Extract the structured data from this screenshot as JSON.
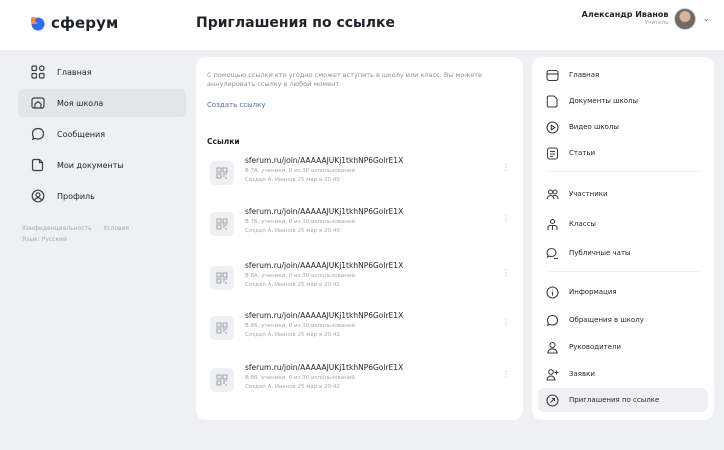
{
  "header": {
    "logo_text": "сферум",
    "page_title": "Приглашения по ссылке",
    "user_name": "Александр Иванов",
    "user_role": "Учитель"
  },
  "left_nav": {
    "items": [
      {
        "label": "Главная",
        "icon": "grid-icon",
        "active": false
      },
      {
        "label": "Моя школа",
        "icon": "school-icon",
        "active": true
      },
      {
        "label": "Сообщения",
        "icon": "chat-icon",
        "active": false
      },
      {
        "label": "Мои документы",
        "icon": "document-icon",
        "active": false
      },
      {
        "label": "Профиль",
        "icon": "profile-icon",
        "active": false
      }
    ],
    "footer_links": [
      "Конфиденциальность",
      "Условия"
    ],
    "language": "Язык: Русский"
  },
  "main": {
    "intro": "С помощью ссылки кто угодно сможет вступить в школу или класс. Вы можете аннулировать ссылку в любой момент.",
    "create_link": "Создать ссылку",
    "section_title": "Ссылки",
    "links": [
      {
        "url": "sferum.ru/join/AAAAAJUKj1tkhNP6GolrE1X",
        "meta": "В 7А, ученики, 0 из 30 использований",
        "author": "Создал А. Иванов 25 мар в 20:40"
      },
      {
        "url": "sferum.ru/join/AAAAAJUKj1tkhNP6GolrE1X",
        "meta": "В 7Б, ученики, 0 из 30 использований",
        "author": "Создал А. Иванов 25 мар в 20:40"
      },
      {
        "url": "sferum.ru/join/AAAAAJUKj1tkhNP6GolrE1X",
        "meta": "В 8А, ученики, 0 из 30 использований",
        "author": "Создал А. Иванов 25 мар в 20:41"
      },
      {
        "url": "sferum.ru/join/AAAAAJUKj1tkhNP6GolrE1X",
        "meta": "В 8Б, ученики, 0 из 30 использований",
        "author": "Создал А. Иванов 25 мар в 20:41"
      },
      {
        "url": "sferum.ru/join/AAAAAJUKj1tkhNP6GolrE1X",
        "meta": "В 8В, ученики, 0 из 30 использований",
        "author": "Создал А. Иванов 25 мар в 20:42"
      }
    ]
  },
  "right_nav": {
    "items": [
      {
        "label": "Главная",
        "icon": "home-icon"
      },
      {
        "label": "Документы школы",
        "icon": "document-icon"
      },
      {
        "label": "Видео школы",
        "icon": "play-icon"
      },
      {
        "label": "Статьи",
        "icon": "article-icon"
      },
      {
        "label": "Участники",
        "icon": "users-icon"
      },
      {
        "label": "Классы",
        "icon": "classes-icon"
      },
      {
        "label": "Публичные чаты",
        "icon": "public-chats-icon"
      },
      {
        "label": "Информация",
        "icon": "info-icon"
      },
      {
        "label": "Обращения в школу",
        "icon": "appeal-icon"
      },
      {
        "label": "Руководители",
        "icon": "leader-icon"
      },
      {
        "label": "Заявки",
        "icon": "add-user-icon"
      },
      {
        "label": "Приглашения по ссылке",
        "icon": "link-invite-icon",
        "active": true
      }
    ]
  },
  "colors": {
    "accent_blue": "#4a6fa5",
    "logo_blue": "#2f6cf6",
    "logo_orange": "#ff8a3d",
    "background": "#eef0f3"
  }
}
